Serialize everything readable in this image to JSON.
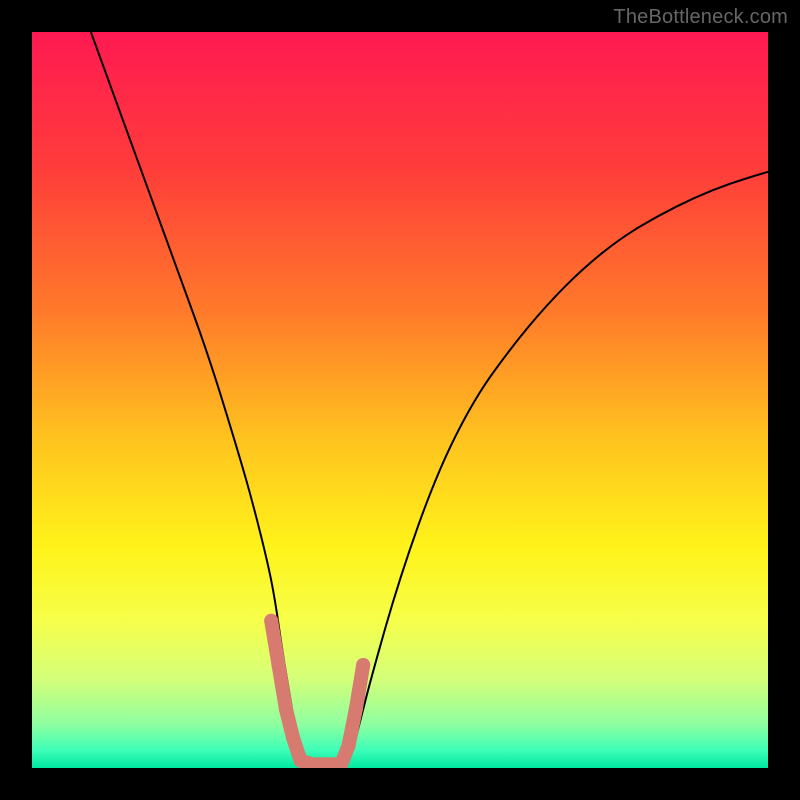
{
  "watermark": "TheBottleneck.com",
  "chart_data": {
    "type": "line",
    "title": "",
    "xlabel": "",
    "ylabel": "",
    "xlim": [
      0,
      100
    ],
    "ylim": [
      0,
      100
    ],
    "series": [
      {
        "name": "main-curve",
        "color": "#000000",
        "x": [
          8,
          12,
          16,
          20,
          24,
          28,
          30,
          32,
          33,
          34,
          35,
          36,
          37,
          38,
          40,
          42,
          43,
          44,
          46,
          50,
          55,
          60,
          65,
          70,
          75,
          80,
          85,
          90,
          95,
          100
        ],
        "y": [
          100,
          89,
          78,
          67,
          56,
          43,
          36,
          28,
          23,
          16,
          10,
          4,
          0.5,
          0.5,
          0.5,
          0.5,
          0.5,
          4,
          12,
          26,
          40,
          50,
          57,
          63,
          68,
          72,
          75,
          77.5,
          79.5,
          81
        ]
      },
      {
        "name": "highlight-segment",
        "color": "#d77a6f",
        "x": [
          32.5,
          33.5,
          34.5,
          35.5,
          36.5,
          38,
          40,
          42,
          43,
          44,
          45
        ],
        "y": [
          20,
          14,
          8,
          4,
          1,
          0.5,
          0.5,
          0.5,
          3,
          8,
          14
        ]
      }
    ],
    "background": {
      "type": "vertical-gradient",
      "stops": [
        {
          "offset": 0.0,
          "color": "#ff1a52"
        },
        {
          "offset": 0.18,
          "color": "#ff3b3b"
        },
        {
          "offset": 0.38,
          "color": "#ff7a2a"
        },
        {
          "offset": 0.55,
          "color": "#ffc21f"
        },
        {
          "offset": 0.7,
          "color": "#fff31a"
        },
        {
          "offset": 0.8,
          "color": "#f6ff4a"
        },
        {
          "offset": 0.88,
          "color": "#d4ff7a"
        },
        {
          "offset": 0.94,
          "color": "#8fff9f"
        },
        {
          "offset": 0.975,
          "color": "#3fffb8"
        },
        {
          "offset": 1.0,
          "color": "#00e8a0"
        }
      ]
    }
  }
}
